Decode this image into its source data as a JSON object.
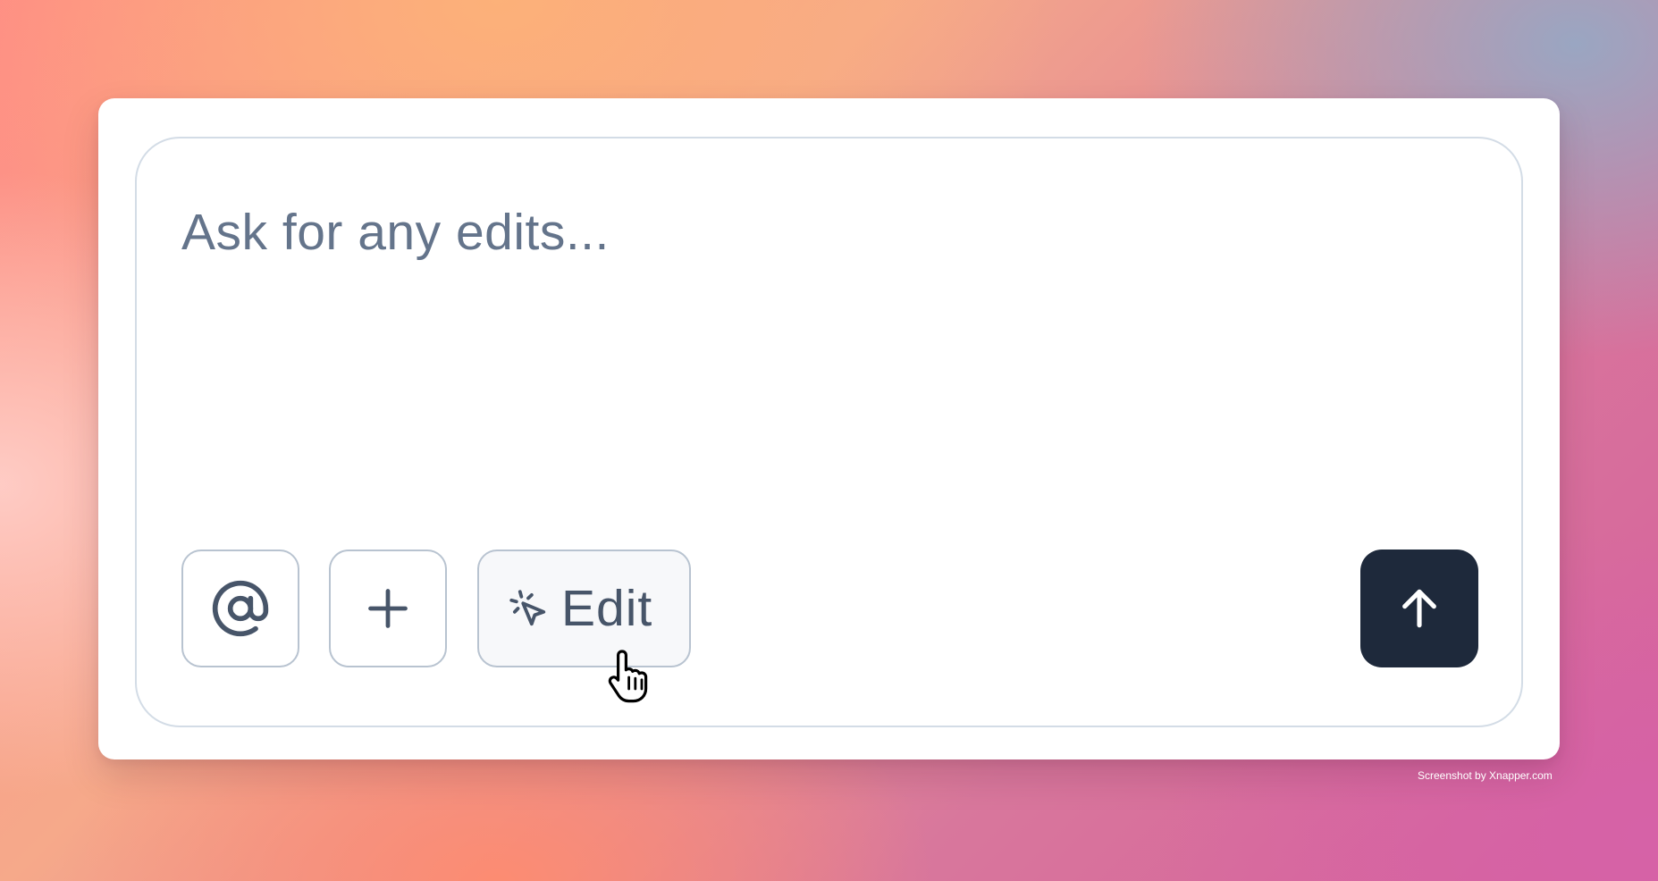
{
  "composer": {
    "placeholder": "Ask for any edits..."
  },
  "toolbar": {
    "mention_icon": "at-sign-icon",
    "add_icon": "plus-icon",
    "edit_icon": "cursor-click-icon",
    "edit_label": "Edit",
    "send_icon": "arrow-up-icon"
  },
  "colors": {
    "send_button": "#1e293b",
    "placeholder_text": "#64748b",
    "button_border": "#b8c3d0",
    "composer_border": "#d3dce6"
  },
  "watermark": "Screenshot by Xnapper.com"
}
